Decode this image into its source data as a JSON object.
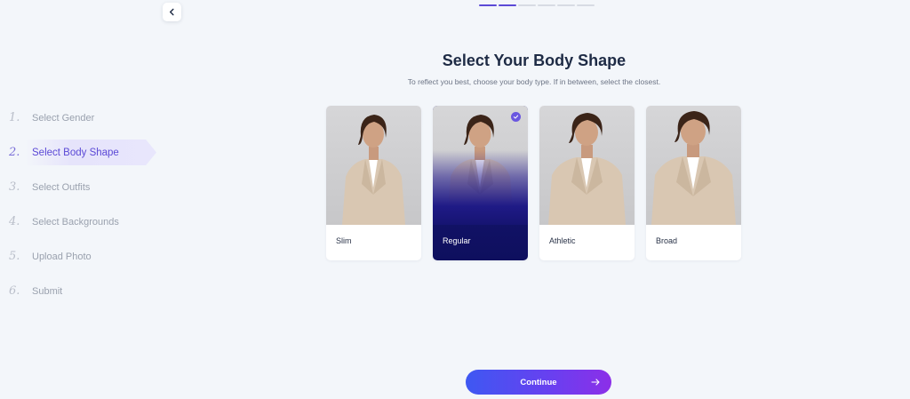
{
  "nav": {
    "back_icon": "chevron-left-icon"
  },
  "progress": {
    "total_segments": 6,
    "completed_segments": 2
  },
  "steps": [
    {
      "num": "1.",
      "label": "Select Gender"
    },
    {
      "num": "2.",
      "label": "Select Body Shape"
    },
    {
      "num": "3.",
      "label": "Select Outfits"
    },
    {
      "num": "4.",
      "label": "Select Backgrounds"
    },
    {
      "num": "5.",
      "label": "Upload Photo"
    },
    {
      "num": "6.",
      "label": "Submit"
    }
  ],
  "active_step": "Select Body Shape",
  "header": {
    "title": "Select Your Body Shape",
    "subtitle": "To reflect you best, choose your body type. If in between, select the closest."
  },
  "cards": [
    {
      "label": "Slim"
    },
    {
      "label": "Regular"
    },
    {
      "label": "Athletic"
    },
    {
      "label": "Broad"
    }
  ],
  "selected_card": "Regular",
  "actions": {
    "continue_label": "Continue",
    "continue_icon": "arrow-right-icon"
  },
  "colors": {
    "accent": "#5b49d6",
    "background": "#f3f6fa",
    "selected_card": "#1c1a7c",
    "button_gradient_start": "#3e58f2",
    "button_gradient_end": "#8c2fe8"
  }
}
